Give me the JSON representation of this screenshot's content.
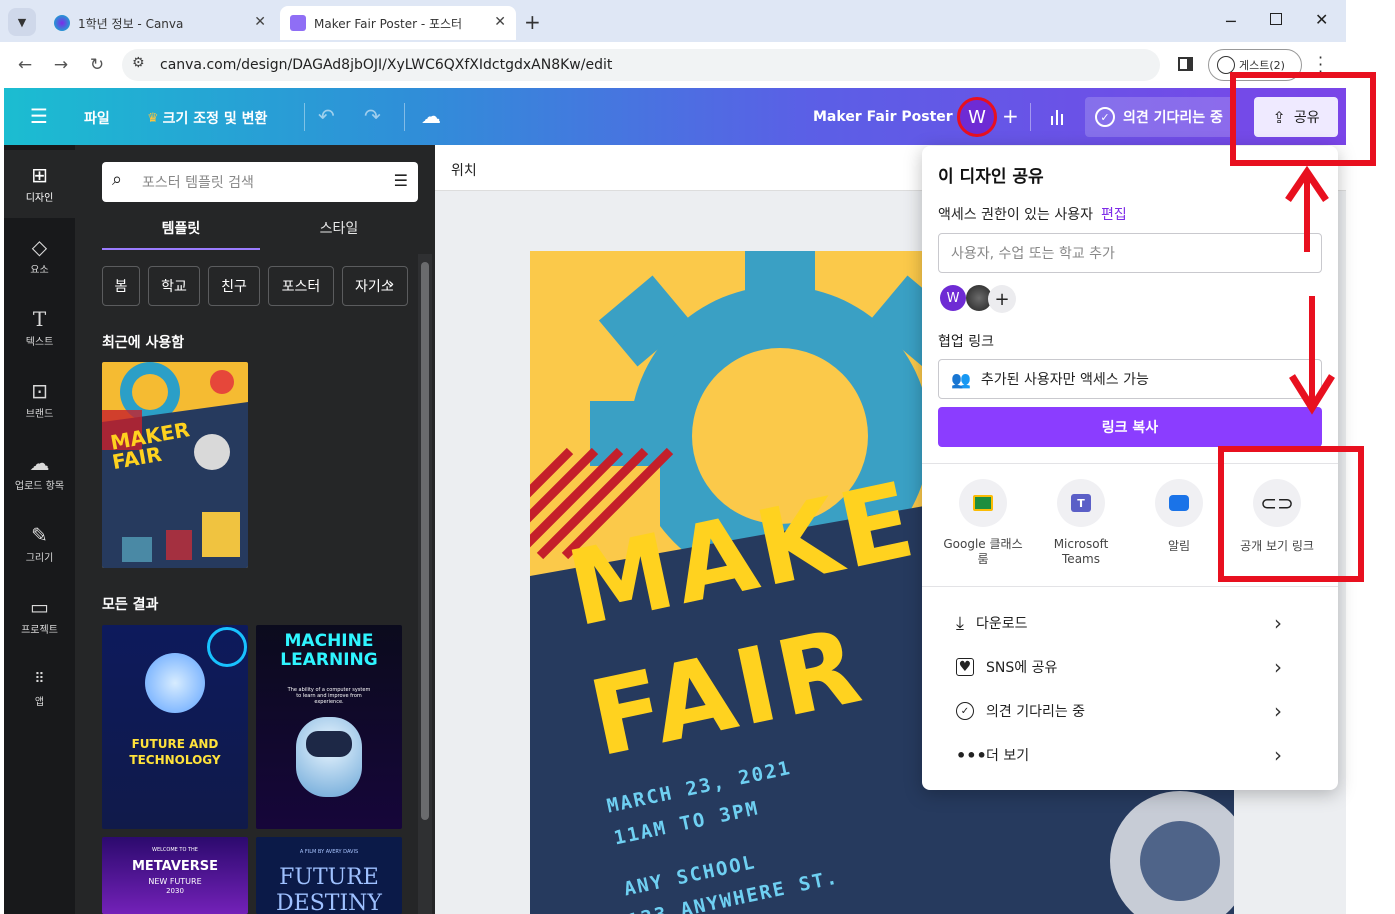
{
  "browser": {
    "tabs": [
      {
        "title": "1학년 정보 - Canva",
        "active": false
      },
      {
        "title": "Maker Fair Poster - 포스터",
        "active": true
      }
    ],
    "new_tab": "+",
    "url": "canva.com/design/DAGAd8jbOJI/XyLWC6QXfXIdctgdxAN8Kw/edit",
    "guest_label": "게스트(2)"
  },
  "topbar": {
    "file": "파일",
    "resize": "크기 조정 및 변환",
    "design_title": "Maker Fair Poster",
    "avatar_letter": "W",
    "feedback": "의견 기다리는 중",
    "share": "공유",
    "colors": {
      "gradient_start": "#1bbdd1",
      "gradient_end": "#7a45e8"
    }
  },
  "rail": [
    {
      "icon": "layout-icon",
      "label": "디자인",
      "active": true
    },
    {
      "icon": "elements-icon",
      "label": "요소",
      "active": false
    },
    {
      "icon": "text-icon",
      "label": "텍스트",
      "active": false
    },
    {
      "icon": "brand-icon",
      "label": "브랜드",
      "active": false
    },
    {
      "icon": "upload-icon",
      "label": "업로드 항목",
      "active": false
    },
    {
      "icon": "draw-icon",
      "label": "그리기",
      "active": false
    },
    {
      "icon": "folder-icon",
      "label": "프로젝트",
      "active": false
    },
    {
      "icon": "apps-icon",
      "label": "앱",
      "active": false
    }
  ],
  "panel": {
    "search_placeholder": "포스터 템플릿 검색",
    "tabs": [
      "템플릿",
      "스타일"
    ],
    "chips": [
      "봄",
      "학교",
      "친구",
      "포스터",
      "자기소"
    ],
    "recent_title": "최근에 사용함",
    "all_results_title": "모든 결과",
    "thumbs": {
      "recent": {
        "title1": "MAKER",
        "title2": "FAIR"
      },
      "future": {
        "line1": "FUTURE AND",
        "line2": "TECHNOLOGY"
      },
      "ml": {
        "line1": "MACHINE",
        "line2": "LEARNING",
        "sub": "The ability of a computer system to learn and improve from experience."
      },
      "metaverse": {
        "top": "WELCOME TO THE",
        "title": "METAVERSE",
        "sub": "NEW FUTURE",
        "year": "2030"
      },
      "destiny": {
        "top": "A FILM BY AVERY DAVIS",
        "title1": "FUTURE",
        "title2": "DESTINY"
      }
    }
  },
  "workspace": {
    "position_label": "위치"
  },
  "poster": {
    "title1": "MAKE",
    "title2": "FAIR",
    "date": "MARCH 23, 2021",
    "time": "11AM TO 3PM",
    "school": "ANY SCHOOL",
    "address": "123 ANYWHERE ST."
  },
  "share_popup": {
    "title": "이 디자인 공유",
    "access_label": "액세스 권한이 있는 사용자",
    "edit_link": "편집",
    "people_placeholder": "사용자, 수업 또는 학교 추가",
    "collab_label": "협업 링크",
    "link_access": "추가된 사용자만 액세스 가능",
    "copy_link": "링크 복사",
    "targets": [
      {
        "icon": "google-classroom-icon",
        "label": "Google 클래스룸"
      },
      {
        "icon": "microsoft-teams-icon",
        "label": "Microsoft Teams"
      },
      {
        "icon": "notification-icon",
        "label": "알림"
      },
      {
        "icon": "link-icon",
        "label": "공개 보기 링크"
      }
    ],
    "menu": [
      {
        "icon": "download-icon",
        "label": "다운로드"
      },
      {
        "icon": "heart-icon",
        "label": "SNS에 공유"
      },
      {
        "icon": "check-circle-icon",
        "label": "의견 기다리는 중"
      },
      {
        "icon": "more-icon",
        "label": "더 보기"
      }
    ],
    "colors": {
      "primary": "#8b3dff"
    }
  },
  "annotations": {
    "highlight_color": "#e8101f"
  }
}
